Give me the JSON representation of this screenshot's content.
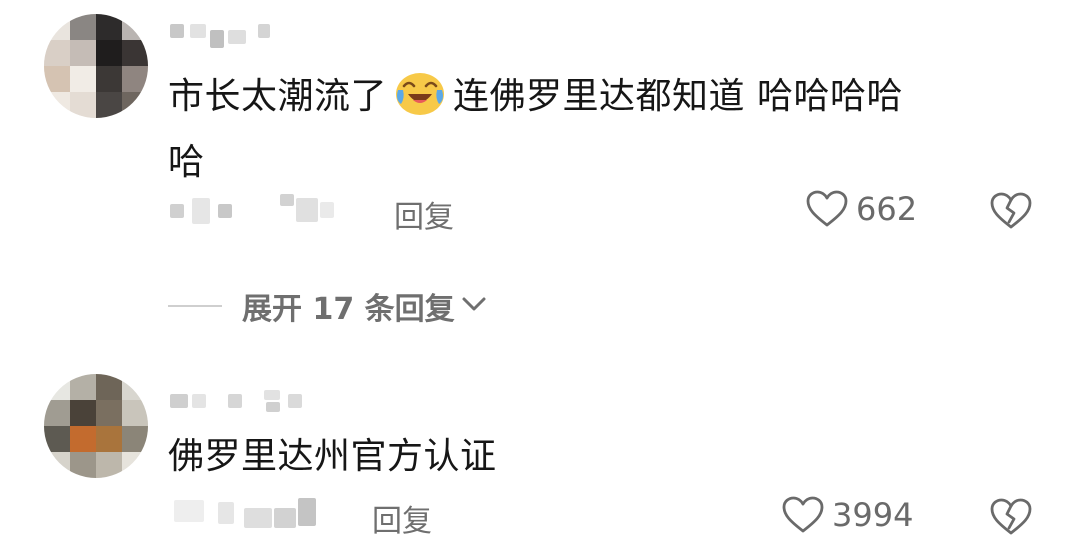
{
  "comments": [
    {
      "text": "市长太潮流了",
      "text_after_emoji": "连佛罗里达都知道 哈哈哈哈",
      "text_line2": "哈",
      "emoji": "laughing-crying-emoji",
      "reply_label": "回复",
      "like_count": "662",
      "expand_label": "展开 17 条回复"
    },
    {
      "text": "佛罗里达州官方认证",
      "reply_label": "回复",
      "like_count": "3994"
    }
  ],
  "icons": {
    "like": "heart-outline-icon",
    "dislike": "broken-heart-icon",
    "expand": "chevron-down-icon"
  },
  "colors": {
    "text": "#161616",
    "secondary": "#6f6f6f",
    "blur": "#d8d8d8",
    "emoji_face": "#f7c948"
  }
}
